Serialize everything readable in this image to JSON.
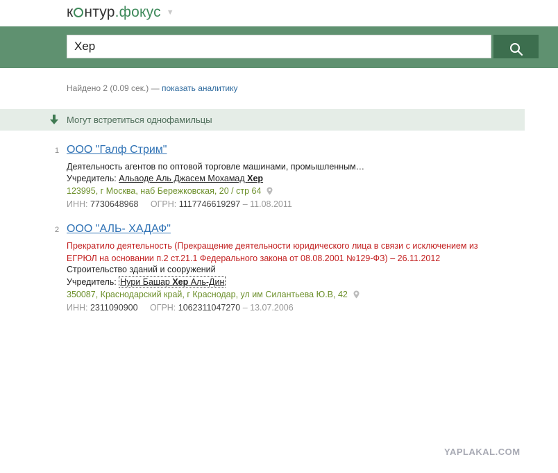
{
  "header": {
    "logo_part1": "к",
    "logo_part2": "нтур",
    "logo_dot": ".",
    "logo_part3": "фокус"
  },
  "search": {
    "query": "Хер"
  },
  "results_info": {
    "found_text": "Найдено 2 (0.09 сек.) — ",
    "analytics_link": "показать аналитику"
  },
  "notice": {
    "text": "Могут встретиться однофамильцы"
  },
  "results": [
    {
      "number": "1",
      "title": "ООО \"Галф Стрим\"",
      "activity": "Деятельность агентов по оптовой торговле машинами, промышленным…",
      "founder_label": "Учредитель: ",
      "founder_name": "Альаоде Аль Джасем Мохамад ",
      "founder_highlight": "Хер",
      "address": "123995, г Москва, наб Бережковская, 20 / стр 64",
      "inn_label": "ИНН: ",
      "inn": "7730648968",
      "ogrn_label": "ОГРН: ",
      "ogrn": "1117746619297",
      "date": " – 11.08.2011"
    },
    {
      "number": "2",
      "title": "ООО \"АЛЬ- ХАДАФ\"",
      "status": "Прекратило деятельность (Прекращение деятельности юридического лица в связи с исключением из ЕГРЮЛ на основании п.2 ст.21.1 Федерального закона от 08.08.2001 №129-ФЗ) – 26.11.2012",
      "activity": "Строительство зданий и сооружений",
      "founder_label": "Учредитель: ",
      "founder_name_pre": "Нури Башар ",
      "founder_highlight": "Хер",
      "founder_name_post": " Аль-Дин",
      "address": "350087, Краснодарский край, г Краснодар, ул им Силантьева Ю.В, 42",
      "inn_label": "ИНН: ",
      "inn": "2311090900",
      "ogrn_label": "ОГРН: ",
      "ogrn": "1062311047270",
      "date": " – 13.07.2006"
    }
  ],
  "watermark": "YAPLAKAL.COM",
  "colors": {
    "brand_green": "#5f9170",
    "button_green": "#3c6e4e",
    "link_blue": "#2f72b5",
    "terminated_red": "#c21e1e",
    "address_green": "#6c8f2a"
  }
}
